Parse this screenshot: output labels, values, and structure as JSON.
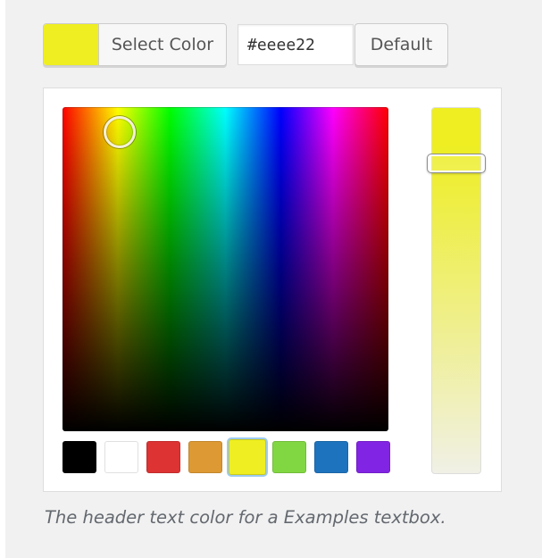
{
  "color_picker": {
    "current_color": "#eeee22",
    "select_label": "Select Color",
    "hex_value": "#eeee22",
    "default_label": "Default",
    "slider_lightness_percent": 13,
    "palette": [
      {
        "name": "black",
        "color": "#000000"
      },
      {
        "name": "white",
        "color": "#ffffff"
      },
      {
        "name": "red",
        "color": "#dd3333"
      },
      {
        "name": "orange",
        "color": "#dd9933"
      },
      {
        "name": "yellow",
        "color": "#eeee22",
        "selected": true
      },
      {
        "name": "green",
        "color": "#81d742"
      },
      {
        "name": "blue",
        "color": "#1e73be"
      },
      {
        "name": "purple",
        "color": "#8224e3"
      }
    ]
  },
  "description": "The header text color for a Examples textbox."
}
